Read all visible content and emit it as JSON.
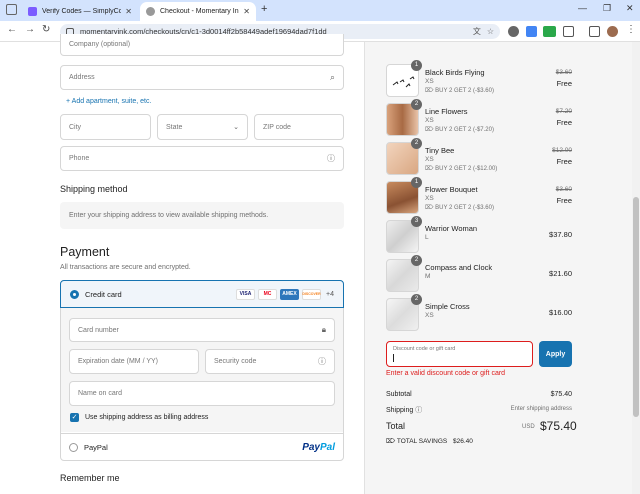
{
  "browser": {
    "tabs": [
      {
        "title": "Verify Codes — SimplyCodes",
        "color": "#7b5cff"
      },
      {
        "title": "Checkout - Momentary Ink",
        "color": "#888888"
      }
    ],
    "url": "momentaryink.com/checkouts/cn/c1-3d0014ff2b58449adef19694dad7f1dd"
  },
  "form": {
    "company_placeholder": "Company (optional)",
    "address_placeholder": "Address",
    "add_apartment": "+ Add apartment, suite, etc.",
    "city_placeholder": "City",
    "state_placeholder": "State",
    "zip_placeholder": "ZIP code",
    "phone_placeholder": "Phone"
  },
  "shipping": {
    "heading": "Shipping method",
    "info": "Enter your shipping address to view available shipping methods."
  },
  "payment": {
    "heading": "Payment",
    "subheading": "All transactions are secure and encrypted.",
    "credit_card_label": "Credit card",
    "card_brands": [
      "VISA",
      "MC",
      "AMEX",
      "DISCOVER"
    ],
    "more_cards": "+4",
    "card_number_placeholder": "Card number",
    "expiration_placeholder": "Expiration date (MM / YY)",
    "security_placeholder": "Security code",
    "name_placeholder": "Name on card",
    "billing_checkbox_label": "Use shipping address as billing address",
    "paypal_label": "PayPal",
    "paypal_logo_a": "Pay",
    "paypal_logo_b": "Pal"
  },
  "remember_me": "Remember me",
  "items": [
    {
      "name": "Black Birds Flying",
      "variant": "XS",
      "discount": "BUY 2 GET 2 (-$3.60)",
      "original": "$3.60",
      "price": "Free",
      "qty": "1"
    },
    {
      "name": "Line Flowers",
      "variant": "XS",
      "discount": "BUY 2 GET 2 (-$7.20)",
      "original": "$7.20",
      "price": "Free",
      "qty": "2"
    },
    {
      "name": "Tiny Bee",
      "variant": "XS",
      "discount": "BUY 2 GET 2 (-$12.00)",
      "original": "$12.00",
      "price": "Free",
      "qty": "2"
    },
    {
      "name": "Flower Bouquet",
      "variant": "XS",
      "discount": "BUY 2 GET 2 (-$3.60)",
      "original": "$3.60",
      "price": "Free",
      "qty": "1"
    },
    {
      "name": "Warrior Woman",
      "variant": "L",
      "discount": "",
      "original": "",
      "price": "$37.80",
      "qty": "3"
    },
    {
      "name": "Compass and Clock",
      "variant": "M",
      "discount": "",
      "original": "",
      "price": "$21.60",
      "qty": "2"
    },
    {
      "name": "Simple Cross",
      "variant": "XS",
      "discount": "",
      "original": "",
      "price": "$16.00",
      "qty": "2"
    }
  ],
  "discount": {
    "placeholder": "Discount code or gift card",
    "apply_label": "Apply",
    "error": "Enter a valid discount code or gift card"
  },
  "summary": {
    "subtotal_label": "Subtotal",
    "subtotal_value": "$75.40",
    "shipping_label": "Shipping",
    "shipping_value": "Enter shipping address",
    "total_label": "Total",
    "currency": "USD",
    "total_value": "$75.40",
    "savings_label": "TOTAL SAVINGS",
    "savings_value": "$26.40"
  }
}
